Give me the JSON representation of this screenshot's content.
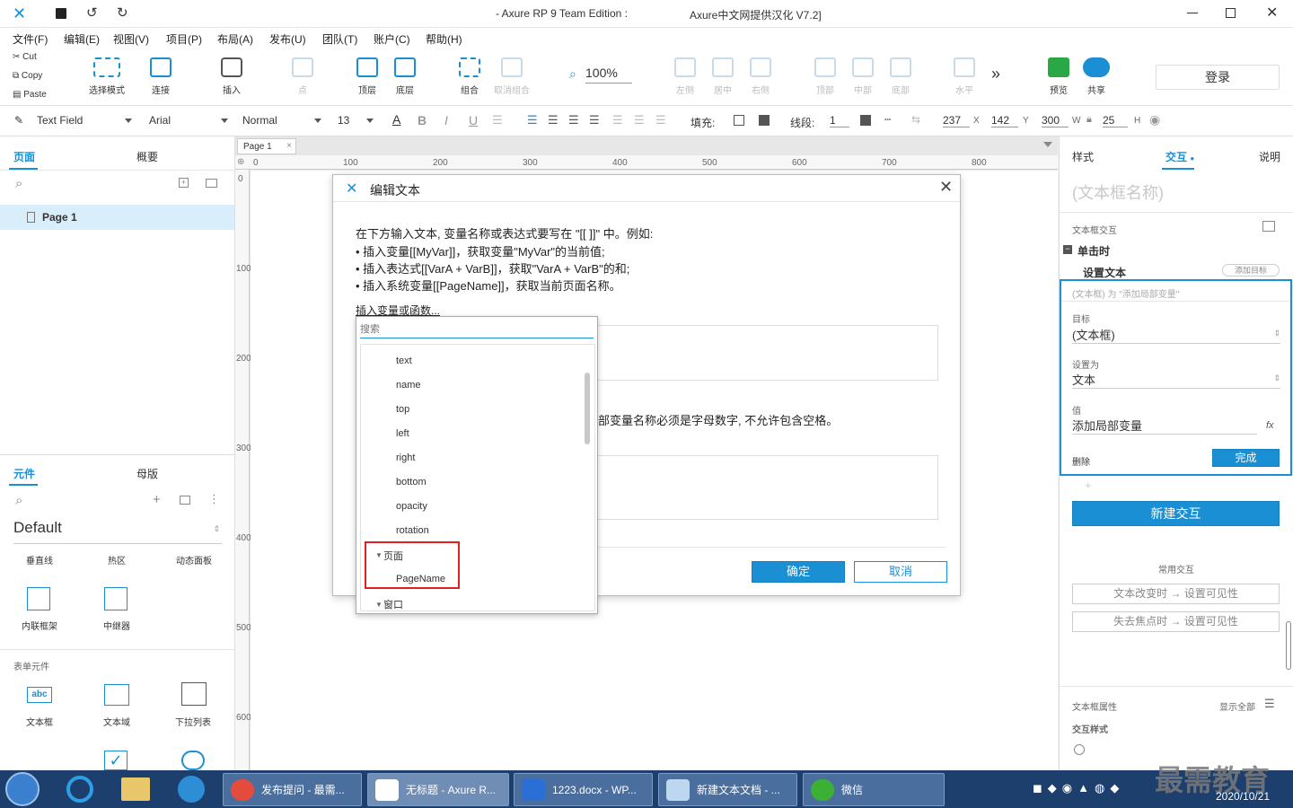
{
  "titlebar": {
    "title": "- Axure RP 9 Team Edition :",
    "title2": "Axure中文网提供汉化 V7.2]"
  },
  "menu": [
    "文件(F)",
    "编辑(E)",
    "视图(V)",
    "项目(P)",
    "布局(A)",
    "发布(U)",
    "团队(T)",
    "账户(C)",
    "帮助(H)"
  ],
  "clipboard": {
    "cut": "Cut",
    "copy": "Copy",
    "paste": "Paste"
  },
  "toolbar": {
    "select_mode": "选择模式",
    "connect": "连接",
    "insert": "插入",
    "point": "点",
    "top": "顶层",
    "bottom": "底层",
    "group": "组合",
    "ungroup": "取消组合",
    "zoom": "100%",
    "left": "左侧",
    "center": "居中",
    "right": "右侧",
    "t": "顶部",
    "m": "中部",
    "b": "底部",
    "horiz": "水平",
    "preview": "预览",
    "share": "共享",
    "login": "登录"
  },
  "format": {
    "style": "Text Field",
    "font": "Arial",
    "weight": "Normal",
    "size": "13",
    "fill_label": "填充:",
    "line_label": "线段:",
    "line_val": "1",
    "x": "237",
    "x_l": "X",
    "y": "142",
    "y_l": "Y",
    "w": "300",
    "w_l": "W",
    "h": "25",
    "h_l": "H"
  },
  "left": {
    "tab_pages": "页面",
    "tab_outline": "概要",
    "page1": "Page 1",
    "tab_widgets": "元件",
    "tab_masters": "母版",
    "library": "Default",
    "w1": "垂直线",
    "w2": "热区",
    "w3": "动态面板",
    "w4": "内联框架",
    "w5": "中继器",
    "form_section": "表单元件",
    "f1": "文本框",
    "f2": "文本域",
    "f3": "下拉列表"
  },
  "canvas": {
    "tab": "Page 1",
    "ruler_h": [
      "0",
      "100",
      "200",
      "300",
      "400",
      "500",
      "600",
      "700",
      "800"
    ],
    "ruler_v": [
      "0",
      "100",
      "200",
      "300",
      "400",
      "500",
      "600"
    ]
  },
  "dialog": {
    "title": "编辑文本",
    "line1": "在下方输入文本, 变量名称或表达式要写在 \"[[ ]]\" 中。例如:",
    "line2": "• 插入变量[[MyVar]]，获取变量\"MyVar\"的当前值;",
    "line3": "• 插入表达式[[VarA + VarB]]，获取\"VarA + VarB\"的和;",
    "line4": "• 插入系统变量[[PageName]]，获取当前页面名称。",
    "insert_link": "插入变量或函数...",
    "partial": "部变量名称必须是字母数字, 不允许包含空格。",
    "ok": "确定",
    "cancel": "取消"
  },
  "popup": {
    "search_placeholder": "搜索",
    "items": [
      "text",
      "name",
      "top",
      "left",
      "right",
      "bottom",
      "opacity",
      "rotation"
    ],
    "group_page": "页面",
    "pagename": "PageName",
    "group_window": "窗口"
  },
  "right": {
    "tab_style": "样式",
    "tab_interact": "交互",
    "tab_notes": "说明",
    "name_placeholder": "(文本框名称)",
    "section": "文本框交互",
    "event": "单击时",
    "action": "设置文本",
    "add_target": "添加目标",
    "summary": "(文本框) 为 \"添加局部变量\"",
    "target_l": "目标",
    "target_v": "(文本框)",
    "setto_l": "设置为",
    "setto_v": "文本",
    "value_l": "值",
    "value_v": "添加局部变量",
    "fx": "fx",
    "delete": "删除",
    "done": "完成",
    "new_interaction": "新建交互",
    "common": "常用交互",
    "c1": "文本改变时 → 设置可见性",
    "c2": "失去焦点时 → 设置可见性",
    "props": "文本框属性",
    "show_all": "显示全部",
    "istyle": "交互样式"
  },
  "taskbar": {
    "t1": "发布提问 - 最需...",
    "t2": "无标题 - Axure R...",
    "t3": "1223.docx - WP...",
    "t4": "新建文本文档 - ...",
    "t5": "微信",
    "date": "2020/10/21",
    "watermark": "最需教育"
  }
}
